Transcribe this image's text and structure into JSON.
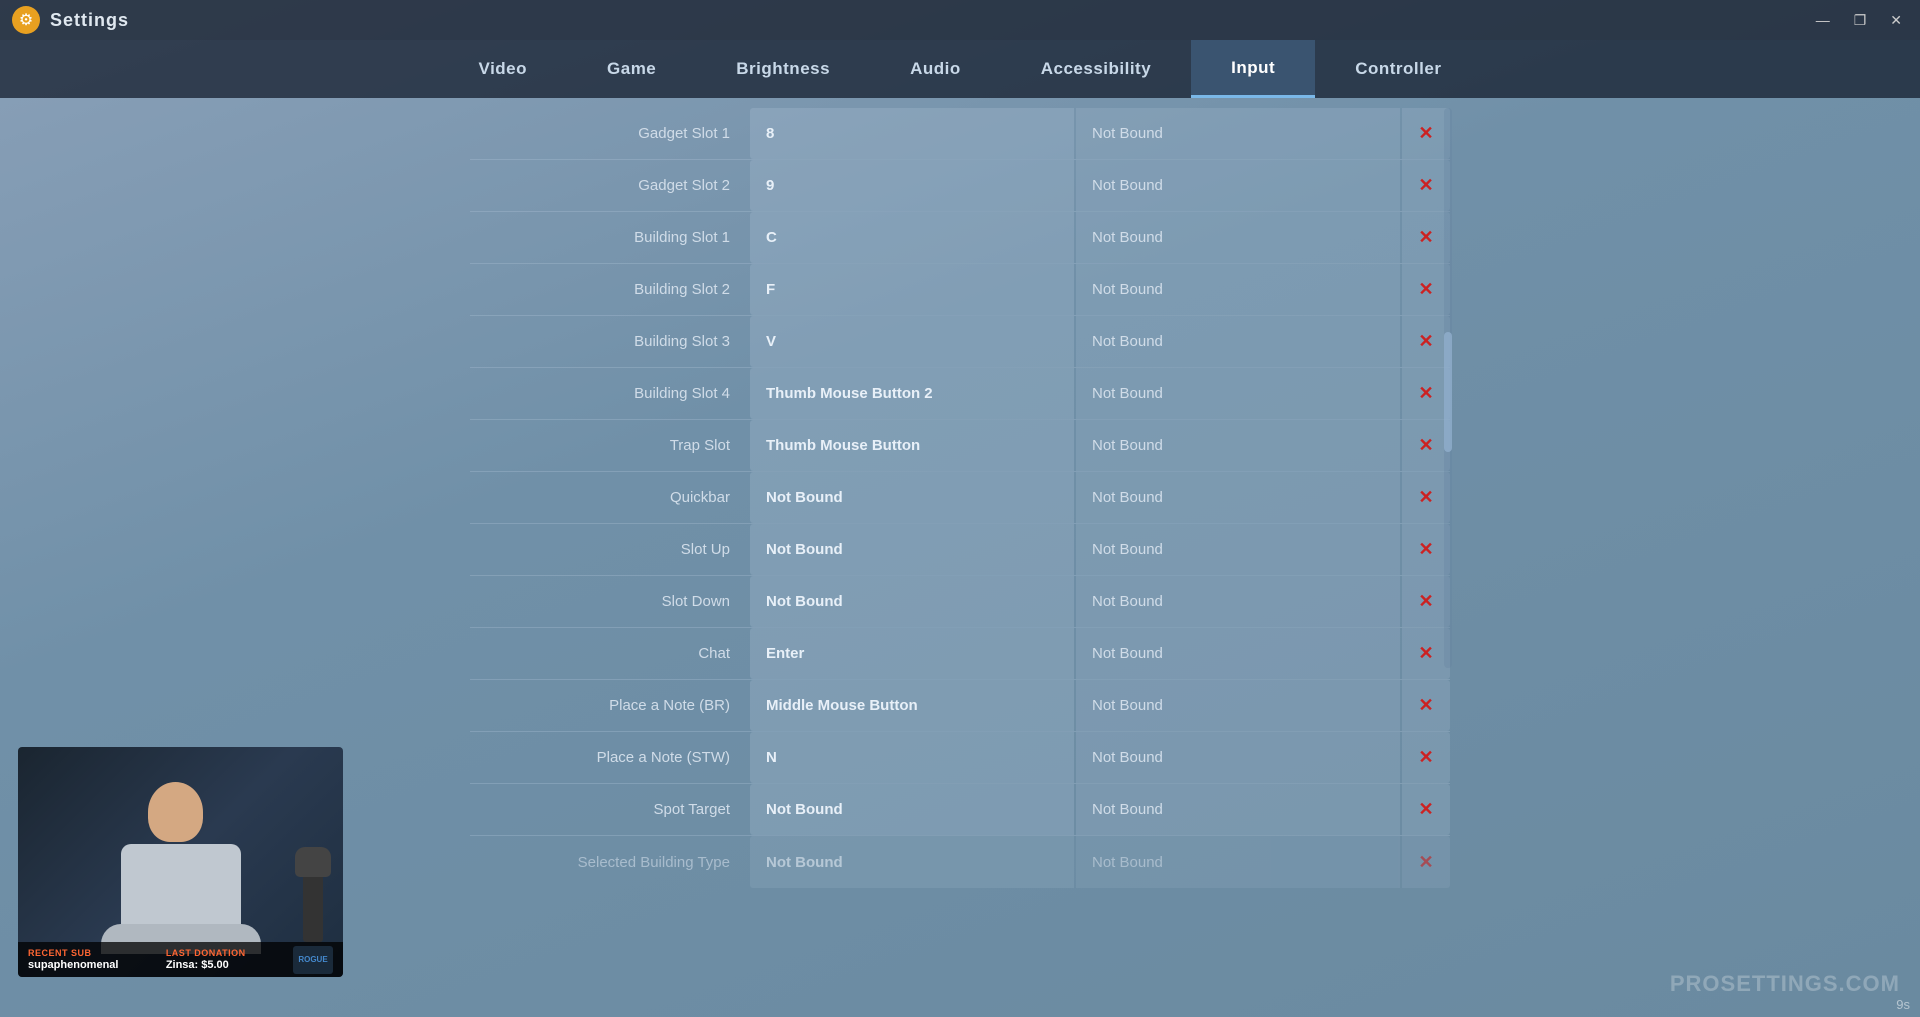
{
  "window": {
    "title": "Settings",
    "gear_icon": "⚙",
    "controls": [
      "—",
      "❐",
      "✕"
    ]
  },
  "nav": {
    "tabs": [
      {
        "label": "Video",
        "active": false
      },
      {
        "label": "Game",
        "active": false
      },
      {
        "label": "Brightness",
        "active": false
      },
      {
        "label": "Audio",
        "active": false
      },
      {
        "label": "Accessibility",
        "active": false
      },
      {
        "label": "Input",
        "active": true
      },
      {
        "label": "Controller",
        "active": false
      }
    ]
  },
  "bindings": [
    {
      "label": "Gadget Slot 1",
      "key": "8",
      "alt": "Not Bound"
    },
    {
      "label": "Gadget Slot 2",
      "key": "9",
      "alt": "Not Bound"
    },
    {
      "label": "Building Slot 1",
      "key": "C",
      "alt": "Not Bound"
    },
    {
      "label": "Building Slot 2",
      "key": "F",
      "alt": "Not Bound"
    },
    {
      "label": "Building Slot 3",
      "key": "V",
      "alt": "Not Bound"
    },
    {
      "label": "Building Slot 4",
      "key": "Thumb Mouse Button 2",
      "alt": "Not Bound"
    },
    {
      "label": "Trap Slot",
      "key": "Thumb Mouse Button",
      "alt": "Not Bound"
    },
    {
      "label": "Quickbar",
      "key": "Not Bound",
      "alt": "Not Bound"
    },
    {
      "label": "Slot Up",
      "key": "Not Bound",
      "alt": "Not Bound"
    },
    {
      "label": "Slot Down",
      "key": "Not Bound",
      "alt": "Not Bound"
    },
    {
      "label": "Chat",
      "key": "Enter",
      "alt": "Not Bound"
    },
    {
      "label": "Place a Note (BR)",
      "key": "Middle Mouse Button",
      "alt": "Not Bound"
    },
    {
      "label": "Place a Note (STW)",
      "key": "N",
      "alt": "Not Bound"
    },
    {
      "label": "Spot Target",
      "key": "Not Bound",
      "alt": "Not Bound"
    },
    {
      "label": "Selected Building Type",
      "key": "Not Bound",
      "alt": "Not Bound"
    }
  ],
  "webcam": {
    "recent_sub_label": "RECENT SUB",
    "recent_sub_value": "supaphenomenal",
    "last_donation_label": "LAST DONATION",
    "last_donation_value": "Zinsa: $5.00"
  },
  "watermark": "PROSETTINGS.COM",
  "timer": "9s",
  "clear_icon": "✕"
}
